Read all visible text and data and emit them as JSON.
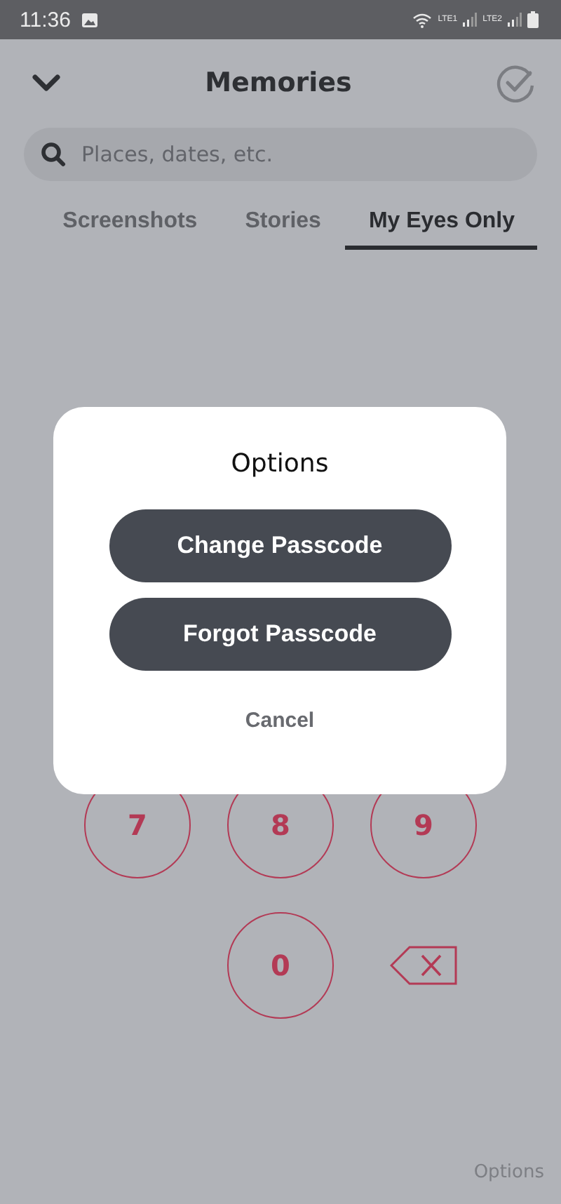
{
  "status_bar": {
    "time": "11:36",
    "sim_labels": [
      "LTE1",
      "LTE2"
    ]
  },
  "header": {
    "title": "Memories"
  },
  "search": {
    "placeholder": "Places, dates, etc."
  },
  "tabs": [
    {
      "label": "Screenshots",
      "selected": false
    },
    {
      "label": "Stories",
      "selected": false
    },
    {
      "label": "My Eyes Only",
      "selected": true
    }
  ],
  "keypad": [
    {
      "kind": "digit",
      "label": "7"
    },
    {
      "kind": "digit",
      "label": "8"
    },
    {
      "kind": "digit",
      "label": "9"
    },
    {
      "kind": "empty"
    },
    {
      "kind": "digit",
      "label": "0"
    },
    {
      "kind": "backspace"
    }
  ],
  "options_link": "Options",
  "dialog": {
    "title": "Options",
    "buttons": [
      "Change Passcode",
      "Forgot Passcode"
    ],
    "cancel": "Cancel"
  }
}
